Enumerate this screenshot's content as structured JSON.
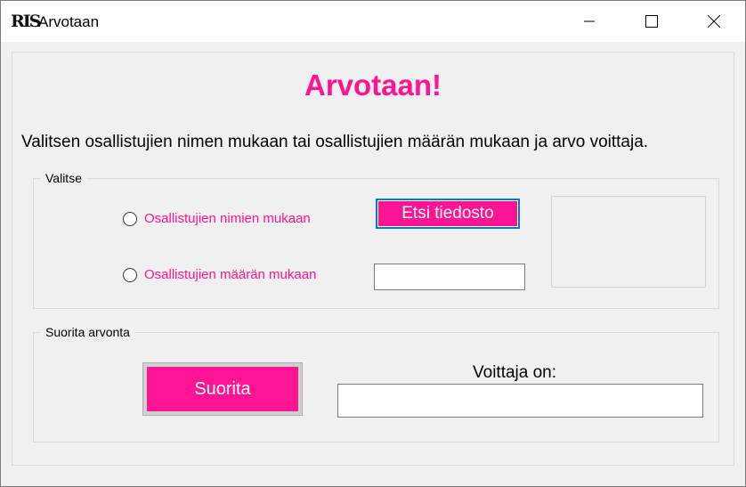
{
  "window": {
    "logo_text": "RIS",
    "title": "Arvotaan",
    "controls": {
      "minimize_icon": "minimize-icon",
      "maximize_icon": "maximize-icon",
      "close_icon": "close-icon"
    }
  },
  "form": {
    "heading": "Arvotaan!",
    "instructions": "Valitsen osallistujien nimen mukaan tai osallistujien määrän mukaan ja arvo voittaja.",
    "accent_color": "#ff1493",
    "select_group": {
      "legend": "Valitse",
      "option_names": "Osallistujien nimien mukaan",
      "option_count": "Osallistujien määrän mukaan",
      "browse_button": "Etsi tiedosto",
      "count_input_value": ""
    },
    "run_group": {
      "legend": "Suorita arvonta",
      "run_button": "Suorita",
      "winner_label": "Voittaja on:",
      "winner_value": ""
    }
  }
}
